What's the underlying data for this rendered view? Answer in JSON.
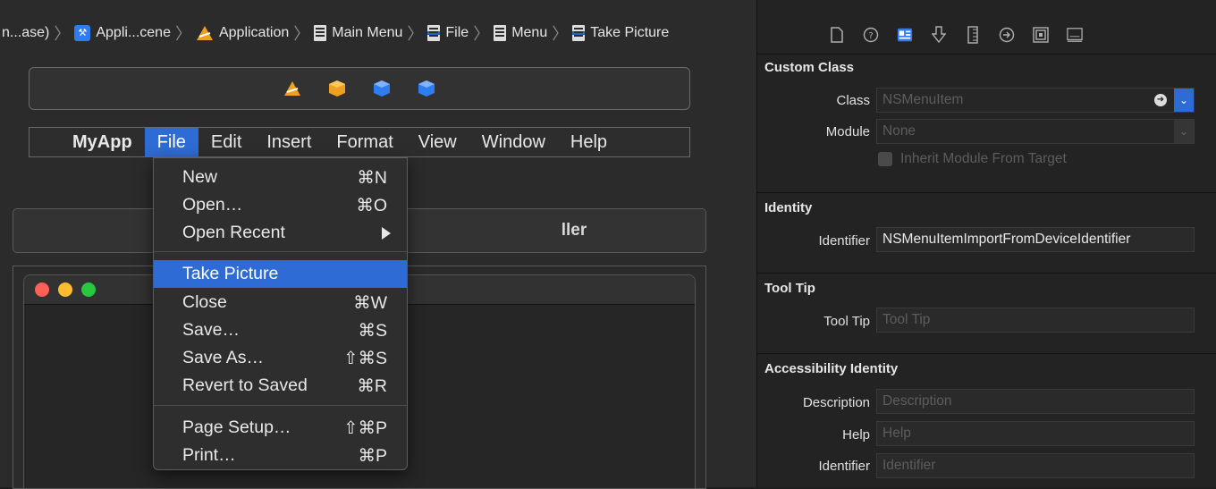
{
  "breadcrumb": {
    "items": [
      "n...ase)",
      "Appli...cene",
      "Application",
      "Main Menu",
      "File",
      "Menu",
      "Take Picture"
    ]
  },
  "menubar": {
    "items": [
      "MyApp",
      "File",
      "Edit",
      "Insert",
      "Format",
      "View",
      "Window",
      "Help"
    ],
    "active": "File"
  },
  "controller_bar": {
    "label": "ller"
  },
  "dropdown": {
    "items": [
      {
        "label": "New",
        "shortcut": "⌘N"
      },
      {
        "label": "Open…",
        "shortcut": "⌘O"
      },
      {
        "label": "Open Recent",
        "shortcut": ""
      },
      {
        "label": "Take Picture",
        "shortcut": ""
      },
      {
        "label": "Close",
        "shortcut": "⌘W"
      },
      {
        "label": "Save…",
        "shortcut": "⌘S"
      },
      {
        "label": "Save As…",
        "shortcut": "⇧⌘S"
      },
      {
        "label": "Revert to Saved",
        "shortcut": "⌘R"
      },
      {
        "label": "Page Setup…",
        "shortcut": "⇧⌘P"
      },
      {
        "label": "Print…",
        "shortcut": "⌘P"
      }
    ],
    "selected": "Take Picture"
  },
  "inspector": {
    "toolbar_icons": [
      "file-icon",
      "help-icon",
      "identity-icon",
      "attributes-icon",
      "size-icon",
      "connections-icon",
      "bindings-icon",
      "effects-icon"
    ],
    "custom_class": {
      "title": "Custom Class",
      "class_label": "Class",
      "class_value": "NSMenuItem",
      "module_label": "Module",
      "module_value": "None",
      "inherit_label": "Inherit Module From Target"
    },
    "identity": {
      "title": "Identity",
      "identifier_label": "Identifier",
      "identifier_value": "NSMenuItemImportFromDeviceIdentifier"
    },
    "tooltip": {
      "title": "Tool Tip",
      "label": "Tool Tip",
      "placeholder": "Tool Tip"
    },
    "accessibility": {
      "title": "Accessibility Identity",
      "description_label": "Description",
      "description_placeholder": "Description",
      "help_label": "Help",
      "help_placeholder": "Help",
      "identifier_label": "Identifier",
      "identifier_placeholder": "Identifier"
    }
  },
  "colors": {
    "accent": "#2f6bd5",
    "close": "#fe5f57",
    "minimize": "#febc2e",
    "zoom": "#28c840"
  }
}
